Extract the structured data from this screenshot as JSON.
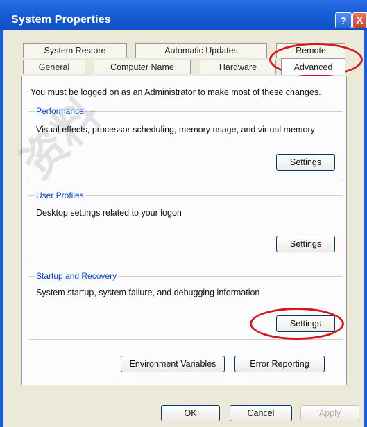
{
  "window": {
    "title": "System Properties",
    "help_glyph": "?",
    "close_glyph": "X"
  },
  "tabs": {
    "row1": [
      "System Restore",
      "Automatic Updates",
      "Remote"
    ],
    "row2": [
      "General",
      "Computer Name",
      "Hardware",
      "Advanced"
    ],
    "active": "Advanced"
  },
  "advanced": {
    "intro": "You must be logged on as an Administrator to make most of these changes.",
    "performance": {
      "title": "Performance",
      "description": "Visual effects, processor scheduling, memory usage, and virtual memory",
      "button": "Settings"
    },
    "user_profiles": {
      "title": "User Profiles",
      "description": "Desktop settings related to your logon",
      "button": "Settings"
    },
    "startup_recovery": {
      "title": "Startup and Recovery",
      "description": "System startup, system failure, and debugging information",
      "button": "Settings"
    },
    "env_button": "Environment Variables",
    "error_button": "Error Reporting"
  },
  "footer": {
    "ok": "OK",
    "cancel": "Cancel",
    "apply": "Apply"
  },
  "annotation_color": "#d8161c",
  "watermark": "资料"
}
